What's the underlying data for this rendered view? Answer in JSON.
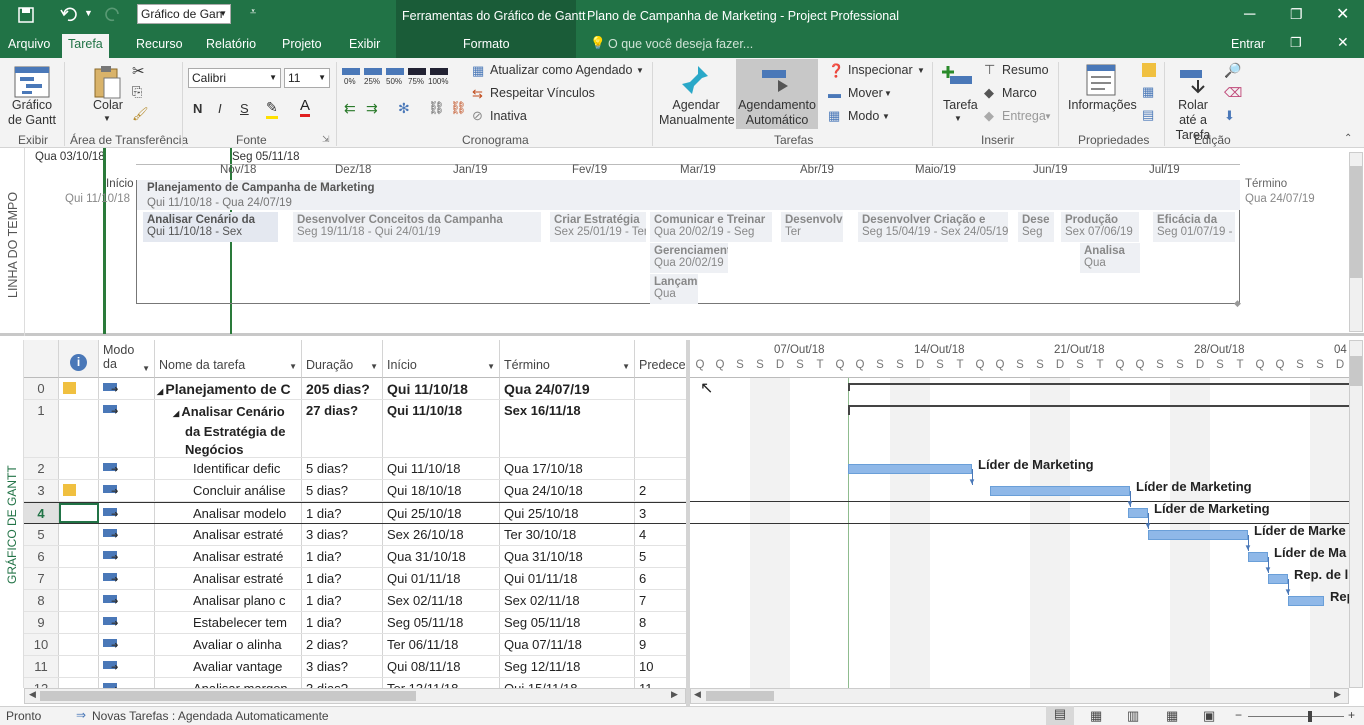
{
  "titlebar": {
    "context_tab": "Ferramentas do Gráfico de Gantt",
    "title": "Plano de Campanha de Marketing - Project Professional",
    "view_combo": "Gráfico de Gan"
  },
  "tabs": [
    "Arquivo",
    "Tarefa",
    "Recurso",
    "Relatório",
    "Projeto",
    "Exibir",
    "Formato"
  ],
  "tellme": "O que você deseja fazer...",
  "signin": "Entrar",
  "ribbon": {
    "gantt_btn": "Gráfico de Gantt",
    "paste_btn": "Colar",
    "font_name": "Calibri",
    "font_size": "11",
    "bold": "N",
    "italic": "I",
    "underline": "S",
    "pct": [
      "0%",
      "25%",
      "50%",
      "75%",
      "100%"
    ],
    "update_sched": "Atualizar como Agendado",
    "respect_links": "Respeitar Vínculos",
    "inactive": "Inativa",
    "manual_sched": "Agendar Manualmente",
    "auto_sched": "Agendamento Automático",
    "inspect": "Inspecionar",
    "move": "Mover",
    "mode": "Modo",
    "task": "Tarefa",
    "summary": "Resumo",
    "milestone": "Marco",
    "deliverable": "Entrega",
    "info": "Informações",
    "scroll_to": "Rolar até a Tarefa",
    "groups": {
      "exibir": "Exibir",
      "clipboard": "Área de Transferência",
      "font": "Fonte",
      "schedule": "Cronograma",
      "tasks": "Tarefas",
      "insert": "Inserir",
      "properties": "Propriedades",
      "editing": "Edição"
    }
  },
  "timeline": {
    "side_label": "LINHA DO TEMPO",
    "today_label": "Qua 03/10/18",
    "current_label": "Seg 05/11/18",
    "months": [
      "Nov/18",
      "Dez/18",
      "Jan/19",
      "Fev/19",
      "Mar/19",
      "Abr/19",
      "Maio/19",
      "Jun/19",
      "Jul/19"
    ],
    "start_label": "Início",
    "start_date": "Qui 11/10/18",
    "end_label": "Término",
    "end_date": "Qua 24/07/19",
    "project_title": "Planejamento de Campanha de Marketing",
    "project_dates": "Qui 11/10/18 - Qua 24/07/19",
    "phases": [
      {
        "name": "Analisar Cenário da",
        "dates": "Qui 11/10/18 - Sex"
      },
      {
        "name": "Desenvolver Conceitos da Campanha",
        "dates": "Seg 19/11/18 - Qui 24/01/19"
      },
      {
        "name": "Criar Estratégia",
        "dates": "Sex 25/01/19 - Ter"
      },
      {
        "name": "Comunicar e Treinar",
        "dates": "Qua 20/02/19 - Seg"
      },
      {
        "name": "Desenvolv",
        "dates": "Ter"
      },
      {
        "name": "Desenvolver Criação e",
        "dates": "Seg 15/04/19 - Sex 24/05/19"
      },
      {
        "name": "Dese",
        "dates": "Seg"
      },
      {
        "name": "Produção",
        "dates": "Sex 07/06/19"
      },
      {
        "name": "Eficácia da",
        "dates": "Seg 01/07/19 -"
      },
      {
        "name": "Gerenciament",
        "dates": "Qua 20/02/19"
      },
      {
        "name": "Analisa",
        "dates": "Qua"
      },
      {
        "name": "Lançamen",
        "dates": "Qua"
      }
    ]
  },
  "grid": {
    "side_label": "GRÁFICO DE GANTT",
    "headers": {
      "mode": "Modo da",
      "name": "Nome da tarefa",
      "duration": "Duração",
      "start": "Início",
      "finish": "Término",
      "pred": "Predece"
    },
    "rows": [
      {
        "id": "0",
        "name": "Planejamento de C",
        "dur": "205 dias?",
        "start": "Qui 11/10/18",
        "finish": "Qua 24/07/19",
        "pred": "",
        "level": 0,
        "bold": true,
        "note": true
      },
      {
        "id": "1",
        "name": "Analisar Cenário da Estratégia de Negócios",
        "dur": "27 dias?",
        "start": "Qui 11/10/18",
        "finish": "Sex 16/11/18",
        "pred": "",
        "level": 1,
        "bold": true,
        "note": false
      },
      {
        "id": "2",
        "name": "Identificar defic",
        "dur": "5 dias?",
        "start": "Qui 11/10/18",
        "finish": "Qua 17/10/18",
        "pred": "",
        "level": 2,
        "bold": false,
        "note": false
      },
      {
        "id": "3",
        "name": "Concluir análise",
        "dur": "5 dias?",
        "start": "Qui 18/10/18",
        "finish": "Qua 24/10/18",
        "pred": "2",
        "level": 2,
        "bold": false,
        "note": true
      },
      {
        "id": "4",
        "name": "Analisar modelo",
        "dur": "1 dia?",
        "start": "Qui 25/10/18",
        "finish": "Qui 25/10/18",
        "pred": "3",
        "level": 2,
        "bold": false,
        "note": false
      },
      {
        "id": "5",
        "name": "Analisar estraté",
        "dur": "3 dias?",
        "start": "Sex 26/10/18",
        "finish": "Ter 30/10/18",
        "pred": "4",
        "level": 2,
        "bold": false,
        "note": false
      },
      {
        "id": "6",
        "name": "Analisar estraté",
        "dur": "1 dia?",
        "start": "Qua 31/10/18",
        "finish": "Qua 31/10/18",
        "pred": "5",
        "level": 2,
        "bold": false,
        "note": false
      },
      {
        "id": "7",
        "name": "Analisar estraté",
        "dur": "1 dia?",
        "start": "Qui 01/11/18",
        "finish": "Qui 01/11/18",
        "pred": "6",
        "level": 2,
        "bold": false,
        "note": false
      },
      {
        "id": "8",
        "name": "Analisar plano c",
        "dur": "1 dia?",
        "start": "Sex 02/11/18",
        "finish": "Sex 02/11/18",
        "pred": "7",
        "level": 2,
        "bold": false,
        "note": false
      },
      {
        "id": "9",
        "name": "Estabelecer tem",
        "dur": "1 dia?",
        "start": "Seg 05/11/18",
        "finish": "Seg 05/11/18",
        "pred": "8",
        "level": 2,
        "bold": false,
        "note": false
      },
      {
        "id": "10",
        "name": "Avaliar o alinha",
        "dur": "2 dias?",
        "start": "Ter 06/11/18",
        "finish": "Qua 07/11/18",
        "pred": "9",
        "level": 2,
        "bold": false,
        "note": false
      },
      {
        "id": "11",
        "name": "Avaliar vantage",
        "dur": "3 dias?",
        "start": "Qui 08/11/18",
        "finish": "Seg 12/11/18",
        "pred": "10",
        "level": 2,
        "bold": false,
        "note": false
      },
      {
        "id": "12",
        "name": "Analisar margen",
        "dur": "3 dias?",
        "start": "Ter 13/11/18",
        "finish": "Qui 15/11/18",
        "pred": "11",
        "level": 2,
        "bold": false,
        "note": false
      }
    ]
  },
  "gantt": {
    "weeks": [
      "07/Out/18",
      "14/Out/18",
      "21/Out/18",
      "28/Out/18",
      "04"
    ],
    "days": [
      "Q",
      "Q",
      "S",
      "S",
      "D",
      "S",
      "T",
      "Q",
      "Q",
      "S",
      "S",
      "D",
      "S",
      "T",
      "Q",
      "Q",
      "S",
      "S",
      "D",
      "S",
      "T",
      "Q",
      "Q",
      "S",
      "S",
      "D",
      "S",
      "T",
      "Q",
      "Q",
      "S",
      "S",
      "D"
    ],
    "resources": [
      "Líder de Marketing",
      "Líder de Marketing",
      "Líder de Marketing",
      "Líder de Marke",
      "Líder de Ma",
      "Rep. de l",
      "Rep."
    ]
  },
  "status": {
    "ready": "Pronto",
    "new_tasks": "Novas Tarefas : Agendada Automaticamente"
  }
}
